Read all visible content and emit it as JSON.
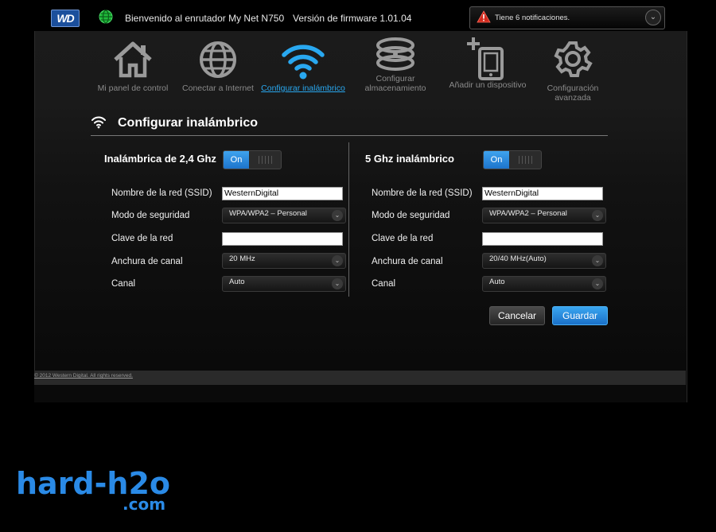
{
  "header": {
    "logo_text": "WD",
    "welcome": "Bienvenido al enrutador My Net N750",
    "firmware": "Versión de firmware 1.01.04",
    "notification": "Tiene 6 notificaciones."
  },
  "nav": [
    {
      "label": "Mi panel de control",
      "icon": "home-icon"
    },
    {
      "label": "Conectar a Internet",
      "icon": "globe-icon"
    },
    {
      "label": "Configurar inalámbrico",
      "icon": "wifi-icon"
    },
    {
      "label": "Configurar almacenamiento",
      "icon": "storage-icon"
    },
    {
      "label": "Añadir un dispositivo",
      "icon": "add-device-icon"
    },
    {
      "label": "Configuración avanzada",
      "icon": "gear-icon"
    }
  ],
  "section_title": "Configurar inalámbrico",
  "band24": {
    "title": "Inalámbrica de 2,4 Ghz",
    "toggle": "On",
    "ssid_label": "Nombre de la red (SSID)",
    "ssid": "WesternDigital",
    "security_label": "Modo de seguridad",
    "security": "WPA/WPA2 – Personal",
    "key_label": "Clave de la red",
    "key": "",
    "width_label": "Anchura de canal",
    "width": "20 MHz",
    "channel_label": "Canal",
    "channel": "Auto"
  },
  "band5": {
    "title": "5 Ghz inalámbrico",
    "toggle": "On",
    "ssid_label": "Nombre de la red (SSID)",
    "ssid": "WesternDigital",
    "security_label": "Modo de seguridad",
    "security": "WPA/WPA2 – Personal",
    "key_label": "Clave de la red",
    "key": "",
    "width_label": "Anchura de canal",
    "width": "20/40 MHz(Auto)",
    "channel_label": "Canal",
    "channel": "Auto"
  },
  "buttons": {
    "cancel": "Cancelar",
    "save": "Guardar"
  },
  "footer": {
    "copyright": "© 2012 Western Digital. All rights reserved."
  },
  "watermark": {
    "hard": "hard-h2o",
    "com": ".com"
  },
  "colors": {
    "accent": "#29a8f0",
    "brand": "#1b4f9c",
    "watermark": "#2a8ae6"
  }
}
